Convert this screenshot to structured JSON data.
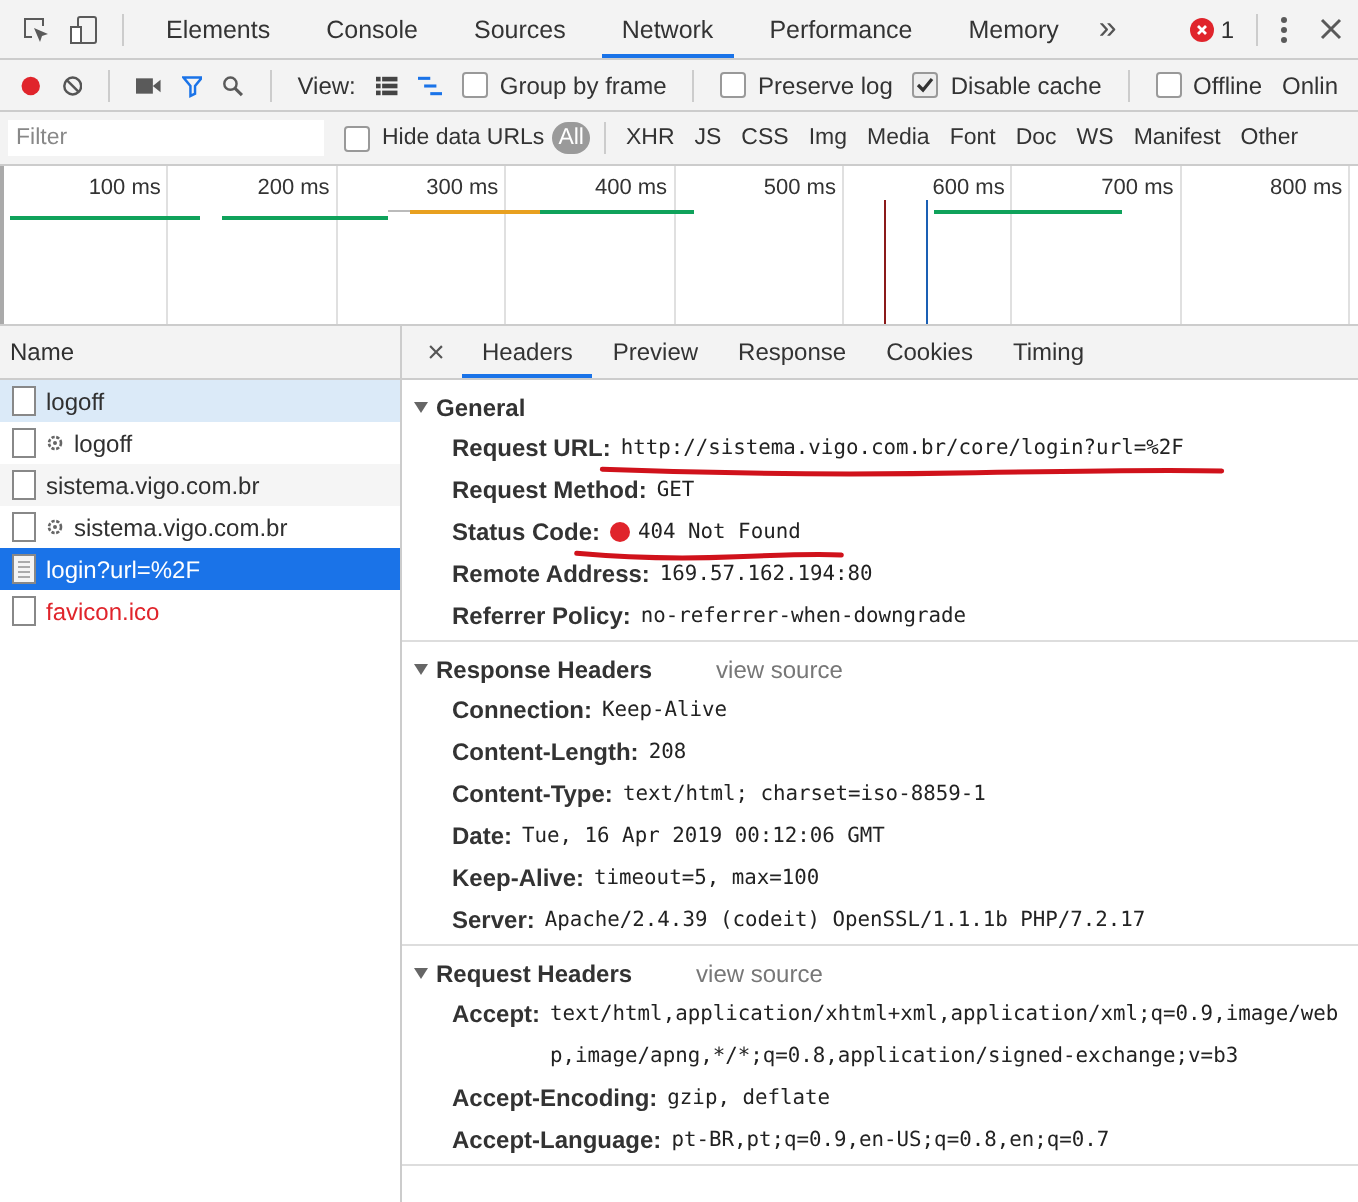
{
  "tabs": [
    {
      "label": "Elements",
      "selected": false
    },
    {
      "label": "Console",
      "selected": false
    },
    {
      "label": "Sources",
      "selected": false
    },
    {
      "label": "Network",
      "selected": true
    },
    {
      "label": "Performance",
      "selected": false
    },
    {
      "label": "Memory",
      "selected": false
    }
  ],
  "more_tabs": "»",
  "error_count": "1",
  "toolbar": {
    "recording": true,
    "filter_on": true,
    "view_label": "View:",
    "checkboxes": [
      {
        "label": "Group by frame",
        "checked": false
      },
      {
        "label": "Preserve log",
        "checked": false
      },
      {
        "label": "Disable cache",
        "checked": true
      },
      {
        "label": "Offline",
        "checked": false
      }
    ],
    "throttle": "Onlin"
  },
  "filter_bar": {
    "placeholder": "Filter",
    "hide_data_urls": {
      "label": "Hide data URLs",
      "checked": false
    },
    "types": [
      {
        "label": "All",
        "selected": true
      },
      {
        "label": "XHR",
        "selected": false
      },
      {
        "label": "JS",
        "selected": false
      },
      {
        "label": "CSS",
        "selected": false
      },
      {
        "label": "Img",
        "selected": false
      },
      {
        "label": "Media",
        "selected": false
      },
      {
        "label": "Font",
        "selected": false
      },
      {
        "label": "Doc",
        "selected": false
      },
      {
        "label": "WS",
        "selected": false
      },
      {
        "label": "Manifest",
        "selected": false
      },
      {
        "label": "Other",
        "selected": false
      }
    ]
  },
  "overview": {
    "ticks": [
      "100 ms",
      "200 ms",
      "300 ms",
      "400 ms",
      "500 ms",
      "600 ms",
      "700 ms",
      "800 ms"
    ]
  },
  "requests": {
    "column": "Name",
    "rows": [
      {
        "name": "logoff",
        "gear": false,
        "hovered": true,
        "selected": false,
        "error": false
      },
      {
        "name": "logoff",
        "gear": true,
        "hovered": false,
        "selected": false,
        "error": false
      },
      {
        "name": "sistema.vigo.com.br",
        "gear": false,
        "hovered": false,
        "selected": false,
        "error": false
      },
      {
        "name": "sistema.vigo.com.br",
        "gear": true,
        "hovered": false,
        "selected": false,
        "error": false
      },
      {
        "name": "login?url=%2F",
        "gear": false,
        "hovered": false,
        "selected": true,
        "error": false
      },
      {
        "name": "favicon.ico",
        "gear": false,
        "hovered": false,
        "selected": false,
        "error": true
      }
    ]
  },
  "details": {
    "close": "×",
    "tabs": [
      {
        "label": "Headers",
        "selected": true
      },
      {
        "label": "Preview",
        "selected": false
      },
      {
        "label": "Response",
        "selected": false
      },
      {
        "label": "Cookies",
        "selected": false
      },
      {
        "label": "Timing",
        "selected": false
      }
    ],
    "sections": [
      {
        "title": "General",
        "expanded": true,
        "rows": [
          {
            "name": "Request URL:",
            "value": "http://sistema.vigo.com.br/core/login?url=%2F",
            "kind": "plain",
            "annotated": true
          },
          {
            "name": "Request Method:",
            "value": "GET",
            "kind": "plain",
            "annotated": false
          },
          {
            "name": "Status Code:",
            "value": "404 Not Found",
            "kind": "status",
            "annotated": true
          },
          {
            "name": "Remote Address:",
            "value": "169.57.162.194:80",
            "kind": "plain",
            "annotated": false
          },
          {
            "name": "Referrer Policy:",
            "value": "no-referrer-when-downgrade",
            "kind": "plain",
            "annotated": false
          }
        ]
      },
      {
        "title": "Response Headers",
        "link": "view source",
        "expanded": true,
        "rows": [
          {
            "name": "Connection:",
            "value": "Keep-Alive",
            "kind": "plain",
            "annotated": false
          },
          {
            "name": "Content-Length:",
            "value": "208",
            "kind": "plain",
            "annotated": false
          },
          {
            "name": "Content-Type:",
            "value": "text/html; charset=iso-8859-1",
            "kind": "plain",
            "annotated": false
          },
          {
            "name": "Date:",
            "value": "Tue, 16 Apr 2019 00:12:06 GMT",
            "kind": "plain",
            "annotated": false
          },
          {
            "name": "Keep-Alive:",
            "value": "timeout=5, max=100",
            "kind": "plain",
            "annotated": false
          },
          {
            "name": "Server:",
            "value": "Apache/2.4.39 (codeit) OpenSSL/1.1.1b PHP/7.2.17",
            "kind": "plain",
            "annotated": false
          }
        ]
      },
      {
        "title": "Request Headers",
        "link": "view source",
        "expanded": true,
        "rows": [
          {
            "name": "Accept:",
            "value": "text/html,application/xhtml+xml,application/xml;q=0.9,image/webp,image/apng,*/*;q=0.8,application/signed-exchange;v=b3",
            "kind": "plain",
            "annotated": false
          },
          {
            "name": "Accept-Encoding:",
            "value": "gzip, deflate",
            "kind": "plain",
            "annotated": false
          },
          {
            "name": "Accept-Language:",
            "value": "pt-BR,pt;q=0.9,en-US;q=0.8,en;q=0.7",
            "kind": "plain",
            "annotated": false
          }
        ]
      }
    ]
  }
}
